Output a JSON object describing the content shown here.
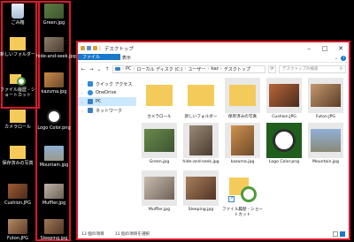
{
  "desktop": {
    "icons": [
      {
        "label": "ごみ箱"
      },
      {
        "label": "Green.jpg"
      },
      {
        "label": "新しいフォルダー"
      },
      {
        "label": "hide-and-seek.jpg"
      },
      {
        "label": "ファイル履歴 - ショートカット"
      },
      {
        "label": "kazuma.jpg"
      },
      {
        "label": "カメラロール"
      },
      {
        "label": "Logo Color.png"
      },
      {
        "label": "保存済みの写真"
      },
      {
        "label": "Mountain.jpg"
      },
      {
        "label": "Cushion.JPG"
      },
      {
        "label": "Muffler.jpg"
      },
      {
        "label": "Futon.JPG"
      },
      {
        "label": "Sleeping.jpg"
      }
    ]
  },
  "explorer": {
    "title": "デスクトップ",
    "ribbon_tabs": [
      "ファイル",
      "ホーム",
      "共有",
      "表示"
    ],
    "address_path": [
      "PC",
      "ローカル ディスク (C:)",
      "ユーザー",
      "kaz",
      "デスクトップ"
    ],
    "search_placeholder": "デスクトップの検索",
    "nav_items": [
      {
        "label": "クイック アクセス"
      },
      {
        "label": "OneDrive"
      },
      {
        "label": "PC"
      },
      {
        "label": "ネットワーク"
      }
    ],
    "files": [
      {
        "name": "カメラロール"
      },
      {
        "name": "新しいフォルダー"
      },
      {
        "name": "保存済みの写真"
      },
      {
        "name": "Cushion.JPG"
      },
      {
        "name": "Futon.JPG"
      },
      {
        "name": "Green.jpg"
      },
      {
        "name": "hide-and-seek.jpg"
      },
      {
        "name": "kazuma.jpg"
      },
      {
        "name": "Logo Color.png"
      },
      {
        "name": "Mountain.jpg"
      },
      {
        "name": "Muffler.jpg"
      },
      {
        "name": "Sleeping.jpg"
      },
      {
        "name": "ファイル履歴 - ショートカット"
      }
    ],
    "status": {
      "count": "13 個の項目",
      "selected": "11 個の項目を選択"
    }
  }
}
